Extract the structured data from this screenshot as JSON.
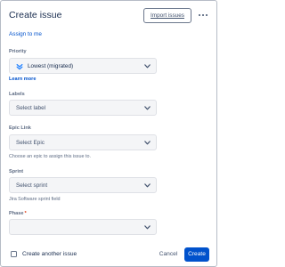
{
  "dialog": {
    "title": "Create issue",
    "import_label": "Import issues",
    "more_icon": "more-icon"
  },
  "assign_link": "Assign to me",
  "priority": {
    "label": "Priority",
    "value": "Lowest (migrated)",
    "icon": "priority-lowest-icon",
    "icon_color": "#2684ff",
    "learn_more": "Learn more"
  },
  "labels": {
    "label": "Labels",
    "placeholder": "Select label"
  },
  "epic_link": {
    "label": "Epic Link",
    "placeholder": "Select Epic",
    "helper": "Choose an epic to assign this issue to."
  },
  "sprint": {
    "label": "Sprint",
    "placeholder": "Select sprint",
    "helper": "Jira Software sprint field"
  },
  "phase": {
    "label": "Phase",
    "required_marker": "*",
    "value": ""
  },
  "footer": {
    "create_another_label": "Create another issue",
    "create_another_checked": false,
    "cancel_label": "Cancel",
    "create_label": "Create"
  },
  "colors": {
    "primary": "#0052cc",
    "link": "#0052cc",
    "text": "#172b4d",
    "subtle_text": "#5e6c84",
    "field_bg": "#f4f5f7",
    "required": "#de350b"
  }
}
